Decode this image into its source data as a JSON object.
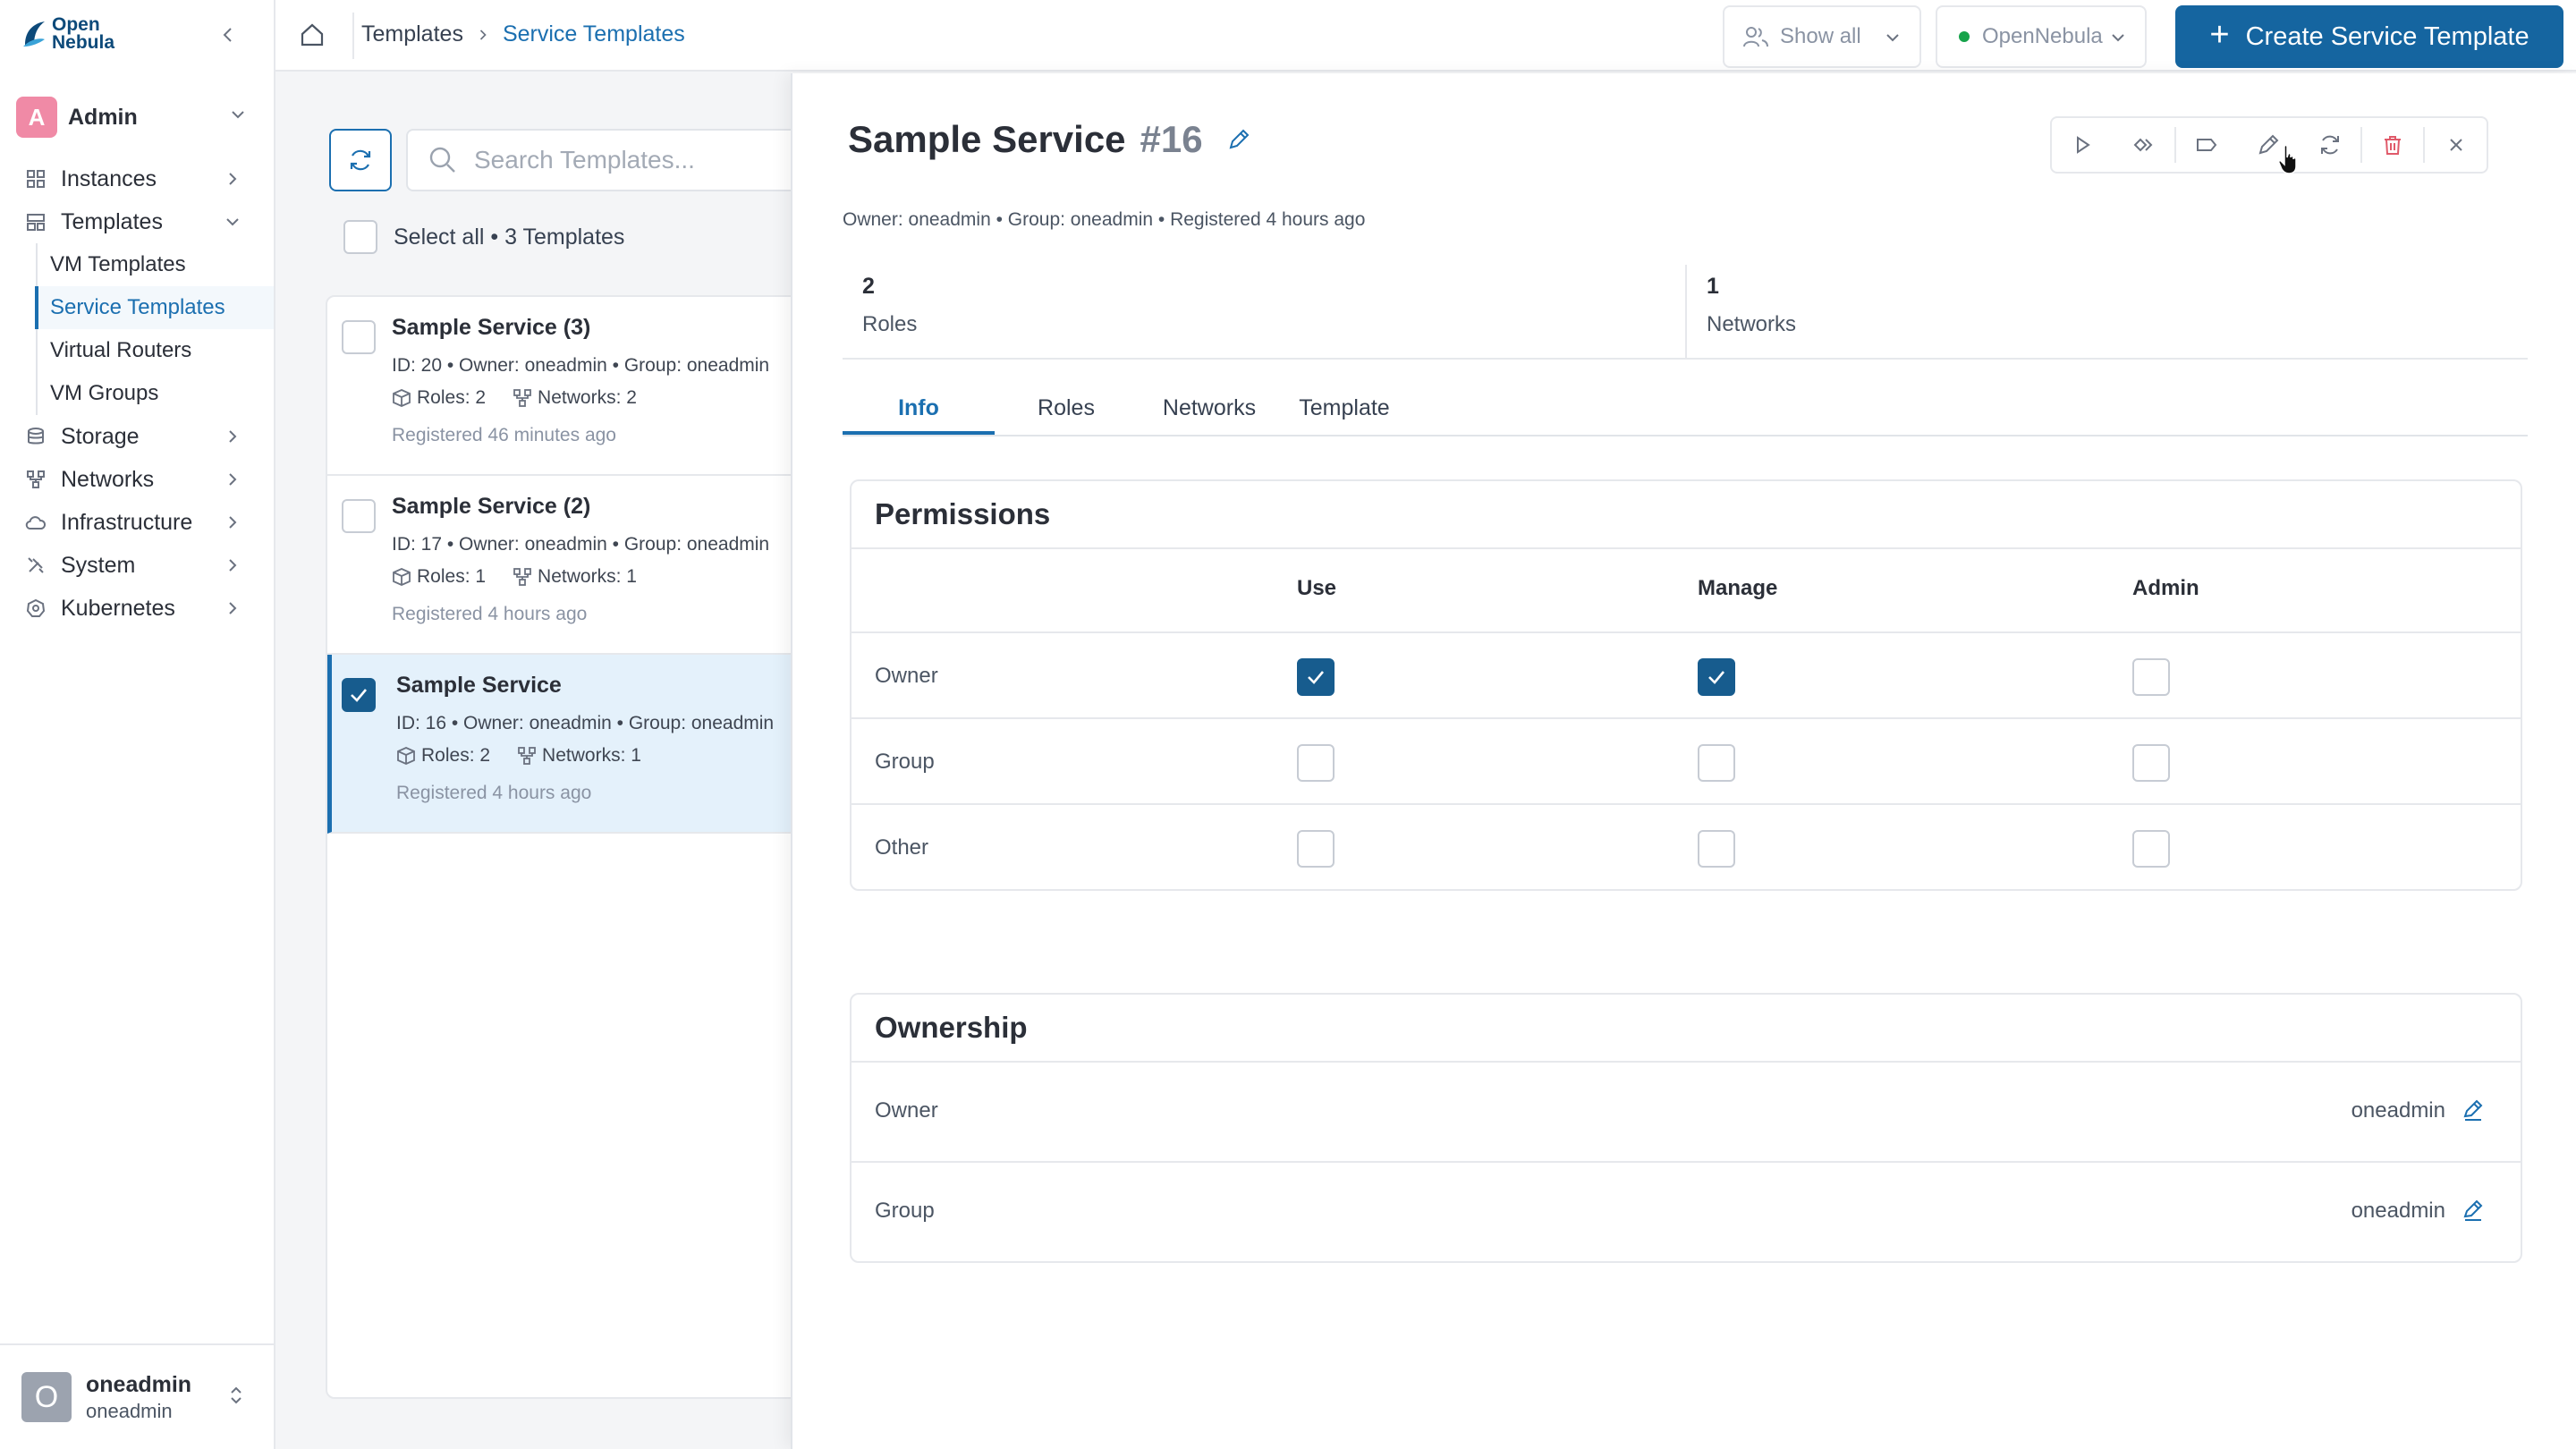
{
  "app": {
    "logo_line1": "Open",
    "logo_line2": "Nebula"
  },
  "sidebar": {
    "user_group": {
      "initial": "A",
      "name": "Admin"
    },
    "nav": [
      {
        "label": "Instances",
        "icon": "instances-icon"
      },
      {
        "label": "Templates",
        "icon": "templates-icon",
        "expanded": true,
        "children": [
          "VM Templates",
          "Service Templates",
          "Virtual Routers",
          "VM Groups"
        ],
        "active_child": "Service Templates"
      },
      {
        "label": "Storage",
        "icon": "storage-icon"
      },
      {
        "label": "Networks",
        "icon": "networks-icon"
      },
      {
        "label": "Infrastructure",
        "icon": "cloud-icon"
      },
      {
        "label": "System",
        "icon": "system-icon"
      },
      {
        "label": "Kubernetes",
        "icon": "kubernetes-icon"
      }
    ],
    "profile": {
      "initial": "O",
      "name": "oneadmin",
      "sub": "oneadmin"
    }
  },
  "topbar": {
    "breadcrumb": [
      "Templates",
      "Service Templates"
    ],
    "filter_label": "Show all",
    "zone_label": "OpenNebula",
    "zone_status_color": "#16a34a",
    "create_label": "Create Service Template"
  },
  "list": {
    "search_placeholder": "Search Templates...",
    "select_all_label": "Select all • 3 Templates",
    "items": [
      {
        "title": "Sample Service (3)",
        "meta": "ID: 20 • Owner: oneadmin • Group: oneadmin",
        "roles": "Roles: 2",
        "networks": "Networks: 2",
        "registered": "Registered 46 minutes ago",
        "selected": false
      },
      {
        "title": "Sample Service (2)",
        "meta": "ID: 17 • Owner: oneadmin • Group: oneadmin",
        "roles": "Roles: 1",
        "networks": "Networks: 1",
        "registered": "Registered 4 hours ago",
        "selected": false
      },
      {
        "title": "Sample Service",
        "meta": "ID: 16 • Owner: oneadmin • Group: oneadmin",
        "roles": "Roles: 2",
        "networks": "Networks: 1",
        "registered": "Registered 4 hours ago",
        "selected": true
      }
    ]
  },
  "detail": {
    "title": "Sample Service",
    "id": "#16",
    "meta": "Owner: oneadmin • Group: oneadmin • Registered 4 hours ago",
    "stats": [
      {
        "value": "2",
        "label": "Roles"
      },
      {
        "value": "1",
        "label": "Networks"
      }
    ],
    "tabs": [
      "Info",
      "Roles",
      "Networks",
      "Template"
    ],
    "active_tab": "Info",
    "actions": [
      "play-icon",
      "clone-icon",
      "label-icon",
      "edit-icon",
      "refresh-icon",
      "trash-icon",
      "close-icon"
    ],
    "permissions": {
      "title": "Permissions",
      "columns": [
        "Use",
        "Manage",
        "Admin"
      ],
      "rows": [
        {
          "label": "Owner",
          "use": true,
          "manage": true,
          "admin": false
        },
        {
          "label": "Group",
          "use": false,
          "manage": false,
          "admin": false
        },
        {
          "label": "Other",
          "use": false,
          "manage": false,
          "admin": false
        }
      ]
    },
    "ownership": {
      "title": "Ownership",
      "rows": [
        {
          "label": "Owner",
          "value": "oneadmin"
        },
        {
          "label": "Group",
          "value": "oneadmin"
        }
      ]
    }
  },
  "colors": {
    "accent": "#1b6fb0",
    "primary_button": "#1565a0",
    "checkbox_checked": "#175c8e",
    "danger": "#e05a6a",
    "selected_row": "#e4f1fb"
  }
}
